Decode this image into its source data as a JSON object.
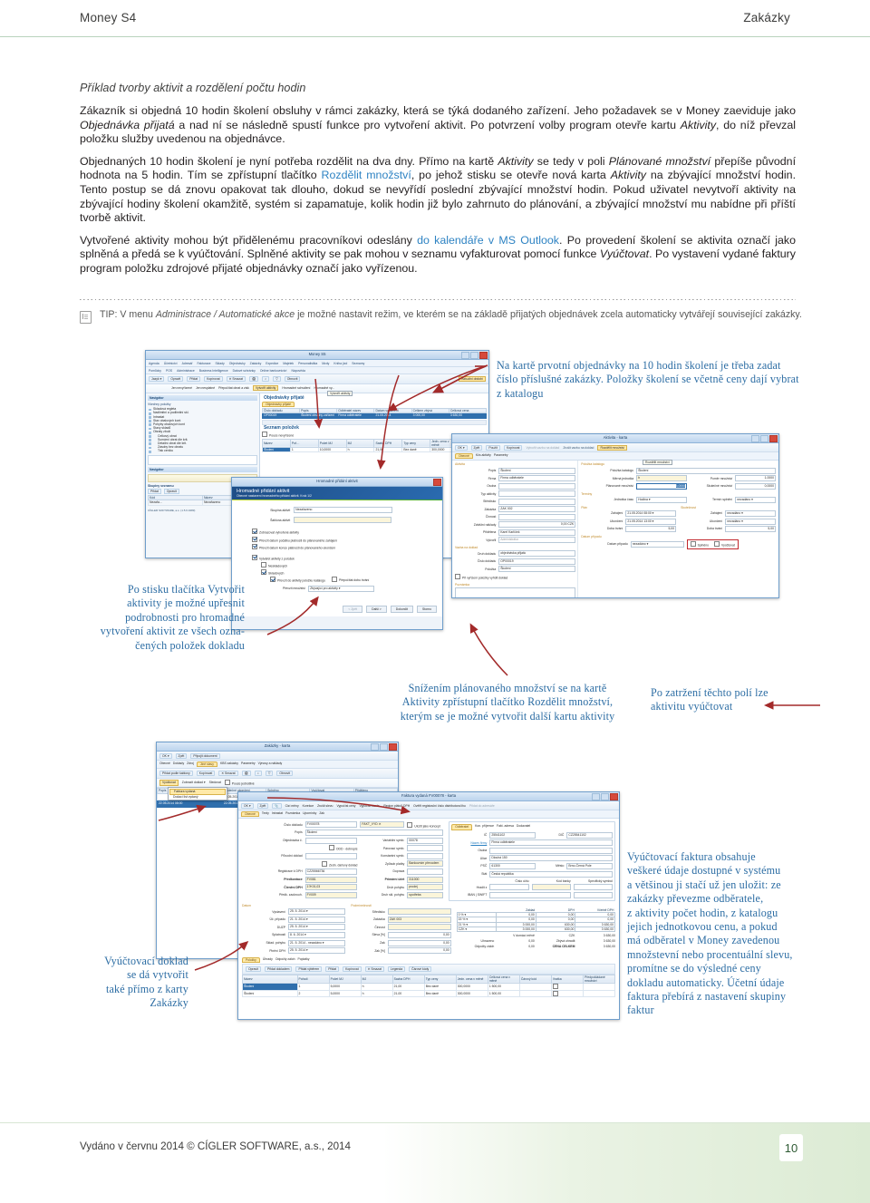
{
  "header": {
    "left_title": "Money S4",
    "right_title": "Zakázky"
  },
  "content": {
    "lead_title": "Příklad tvorby aktivit a rozdělení počtu hodin",
    "paragraph1_a": "Zákazník si objedná 10 hodin školení obsluhy v rámci zakázky, která se týká dodaného zařízení. Jeho požadavek se v Money zaeviduje jako ",
    "paragraph1_em1": "Objednávka přijatá",
    "paragraph1_b": " a nad ní se následně spustí funkce pro vytvoření aktivit. Po potvrzení volby program otevře kartu ",
    "paragraph1_em2": "Aktivity",
    "paragraph1_c": ", do níž převzal položku služby uvedenou na objednávce.",
    "paragraph2_a": "Objednaných 10 hodin školení je nyní potřeba rozdělit na dva dny. Přímo na kartě ",
    "paragraph2_em1": "Aktivity",
    "paragraph2_b": " se tedy v poli ",
    "paragraph2_em2": "Plánované množství",
    "paragraph2_c": " přepíše původní hodnota na 5 hodin. Tím se zpřístupní tlačítko ",
    "paragraph2_link": "Rozdělit množství",
    "paragraph2_d": ", po jehož stisku se otevře nová karta ",
    "paragraph2_em3": "Aktivity",
    "paragraph2_e": " na zbývající množství hodin. Tento postup se dá znovu opakovat tak dlouho, dokud se nevyřídí poslední zbývající množství hodin. Pokud uživatel nevytvoří aktivity na zbývající hodiny školení okamžitě, systém si zapamatuje, kolik hodin již bylo zahrnuto do plánování, a zbývající množství mu nabídne při příští tvorbě aktivit.",
    "paragraph3_a": "Vytvořené aktivity mohou být přidělenému pracovníkovi odeslány ",
    "paragraph3_link": "do kalendáře v MS Outlook",
    "paragraph3_b": ". Po provedení školení se aktivita označí jako splněná a předá se k vyúčtování. Splněné aktivity se pak mohou v seznamu vyfakturovat pomocí funkce ",
    "paragraph3_em1": "Vyúčtovat",
    "paragraph3_c": ". Po vystavení vydané faktury program položku zdrojové přijaté objednávky označí jako vyřízenou."
  },
  "tip": {
    "label": "TIP:",
    "text_a": " V menu ",
    "em1": "Administrace / Automatické akce",
    "text_b": " je možné nastavit režim, ve kterém se na základě přijatých objednávek zcela automaticky vytvářejí související zakázky."
  },
  "annotations": [
    {
      "id": "note-order-card",
      "lines": [
        "Na kartě prvotní objednávky na 10 hodin školení je třeba zadat",
        "číslo příslušné zakázky. Položky školení se včetně ceny dají vybrat",
        "z katalogu"
      ]
    },
    {
      "id": "note-create-activities",
      "lines": [
        "Po stisku tlačítka Vytvořit",
        "aktivity je možné upřesnit",
        "podrobnosti pro hromadné",
        "vytvoření aktivit ze všech ozna-",
        "čených položek dokladu"
      ]
    },
    {
      "id": "note-split-quantity",
      "lines": [
        "Snížením plánovaného množství se na kartě",
        "Aktivity zpřístupní tlačítko Rozdělit množství,",
        "kterým se je možné vytvořit další kartu aktivity"
      ]
    },
    {
      "id": "note-check-fields",
      "lines": [
        "Po zatržení těchto polí lze",
        "aktivitu vyúčtovat"
      ]
    },
    {
      "id": "note-billing-doc",
      "lines": [
        "Vyúčtovací doklad",
        "se dá vytvořit",
        "také přímo z karty",
        "Zakázky"
      ]
    },
    {
      "id": "note-invoice",
      "lines": [
        "Vyúčtovací faktura obsahuje",
        "veškeré údaje dostupné v systému",
        "a většinou ji stačí už jen uložit: ze",
        "zakázky převezme odběratele,",
        "z aktivity počet hodin, z katalogu",
        "jejich jednotkovou cenu, a pokud",
        "má odběratel v Money zavedenou",
        "množstevní nebo procentuální slevu,",
        "promítne se do výsledné ceny",
        "dokladu automaticky. Účetní údaje",
        "faktura přebírá z nastavení skupiny",
        "faktur"
      ]
    }
  ],
  "screenshots": {
    "money_main": {
      "window_title": "Money S5",
      "menu_row1": [
        "Agenda",
        "Účetnictví",
        "Adresář",
        "Fakturace",
        "Sklady",
        "Objednávky",
        "Zakázky",
        "Expedice",
        "Majetek",
        "Personalistika",
        "Mzdy",
        "Kniha jízd",
        "Seznamy"
      ],
      "menu_row2": [
        "Pomůcky",
        "POS",
        "Administrace",
        "Business Intelligence",
        "Datové schránky",
        "Online bankovnictví",
        "Nápověda"
      ],
      "toolbar": [
        "Jazyk",
        "Opravit",
        "Přidat",
        "Kopírovat",
        "Smazat",
        "Obnovit"
      ],
      "toolbar_highlight": "Aktuální období",
      "subtoolbar": [
        "Jen nevyřízené",
        "Jen nesplatné",
        "Přepočítat obrat a zisk"
      ],
      "subtoolbar_highlight": "Vytvořit aktivity",
      "subtoolbar_rest": [
        "Hromadné schválení",
        "Hromadné vy..."
      ],
      "navigator_title": "Navigátor",
      "navigator_sub": "Všechny položky",
      "navigator_items": [
        "Skladová regleta",
        "Nadlimitní a podlimitní skl.",
        "Intrastat",
        "Stav obalových kont",
        "Pohyby obalových kont",
        "Stavy skladů",
        "Obraty zboží",
        "Celkový obrat",
        "Sumární obrat dle kmb",
        "Detailní obrat dle kmb",
        "Zásoby bez obratu",
        "Tisk ceníku"
      ],
      "navigator_panel2": "Navigátor",
      "groups_title": "Skupiny seznamu",
      "groups_buttons": [
        "Přidat",
        "Opravit"
      ],
      "groups_cols": [
        "Kód",
        "Název"
      ],
      "groups_row": [
        "Nezařa...",
        "Nezařazeno"
      ],
      "statusbar": "CÍGLER SOFTWARE, a.s. (1.5.6.3483)",
      "list_title": "Objednávky přijaté",
      "list_tab": "Objednávky přijaté",
      "list_columns": [
        "Číslo dokladu",
        "Popis",
        "Odběratel název",
        "Datum vystavení",
        "Celkem zbývá",
        "Celková cena"
      ],
      "list_row": [
        "OP00019",
        "Školení obsluhy zařízení",
        "Firma odběratele",
        "21.05.2014",
        "3 000,00",
        "3 630,00"
      ],
      "items_title": "Seznam položek",
      "items_filter": "Pouze nevyřízené",
      "items_columns": [
        "Název",
        "Pořadí",
        "Počet MJ",
        "MJ",
        "Sazba DPH",
        "Typ ceny",
        "Jedn. cena v měně",
        "Celková cena v měně"
      ],
      "items_row": [
        "Školení",
        "1",
        "10,0000",
        "h",
        "21,00",
        "Bez daně",
        "300,0000",
        "3 000,00"
      ],
      "tooltip": "Vytvořit aktivity"
    },
    "bulk_wizard": {
      "window_title": "Hromadné přidání aktivit",
      "wizard_title": "Hromadné přidání aktivit",
      "wizard_subtitle": "Obecné nastavení hromadného přidání aktivit. Krok 1/2",
      "field_group_label": "Skupina aktivit",
      "field_group_value": "Nezařazeno",
      "field_template_label": "Šablona aktivit",
      "field_template_value": "",
      "checks": [
        {
          "label": "Zobrazovat vytvořené aktivity",
          "checked": true
        },
        {
          "label": "Převzít datum počátku platnosti do plánovaného zahájení",
          "checked": true
        },
        {
          "label": "Převzít datum konce platnosti do plánovaného ukončení",
          "checked": true
        },
        {
          "label": "Vytvářet aktivity z položek",
          "checked": true
        },
        {
          "label": "Nesk1adových",
          "checked": false
        },
        {
          "label": "Skladových",
          "checked": true
        },
        {
          "label": "Převzít do aktivity položku katalogu",
          "checked": true
        },
        {
          "label": "Přepočítat dobu trvání",
          "checked": false
        }
      ],
      "transfer_label": "Převzít množství",
      "transfer_value": "Zbývající pro aktivity",
      "buttons": [
        "< Zpět",
        "Další >",
        "Dokončit",
        "Storno"
      ]
    },
    "activity_card": {
      "window_title": "Aktivita - karta",
      "toolbar": [
        "OK",
        "Zpět",
        "Použít",
        "Kopírovat",
        "Vytvořit vazbu na doklad",
        "Zrušit vazbu na doklad"
      ],
      "toolbar_highlight": "Rozdělit množství",
      "tabs": [
        "Obecné",
        "Kčs aktivity",
        "Parametry"
      ],
      "section_activity": "Aktivita",
      "left_fields": [
        {
          "label": "Popis",
          "value": "Školení"
        },
        {
          "label": "Firma",
          "value": "Firma odběratele"
        },
        {
          "label": "Osoba",
          "value": ""
        },
        {
          "label": "Typ aktivity",
          "value": ""
        },
        {
          "label": "Středisko",
          "value": ""
        },
        {
          "label": "Zakázka",
          "value": "ZAK 002"
        },
        {
          "label": "Činnost",
          "value": ""
        },
        {
          "label": "Zvláštní náklady",
          "value": ""
        },
        {
          "label": "Přidělena",
          "value": "Karel Karlíček"
        },
        {
          "label": "Vytvořil",
          "value": "Administrátor"
        }
      ],
      "section_doc": "Vazba na doklad",
      "doc_fields": [
        {
          "label": "Druh dokladu",
          "value": "objednávka přijatá"
        },
        {
          "label": "Číslo dokladu",
          "value": "OP00019"
        },
        {
          "label": "Položka",
          "value": "Školení"
        }
      ],
      "doc_check": "Při vyřízení položky vyřídit doklad",
      "section_note": "Poznámka",
      "section_catalog": "Položka katalogu",
      "catalog_fields": [
        {
          "label": "Položka katalogu",
          "value": "Školení"
        },
        {
          "label": "Měrná jednotka",
          "value": "h"
        },
        {
          "label": "Plánované množství",
          "value": "5,0000"
        },
        {
          "label": "Poměr množství",
          "value": "1,0000"
        },
        {
          "label": "Skutečné množství",
          "value": "0,0000"
        }
      ],
      "section_terms": "Termíny",
      "term_unit_label": "Jednotka času",
      "term_unit_value": "Hodina",
      "term_done_label": "Termín splnění",
      "term_done_value": "nezadáno",
      "section_plan": "Plán",
      "plan_rows": [
        {
          "label": "Zahájení",
          "value": "21.05.2014 08:00"
        },
        {
          "label": "Ukončení",
          "value": "21.05.2014 13:00"
        },
        {
          "label": "Doba trvání",
          "value": "5,00"
        }
      ],
      "section_real": "Skutečnost",
      "real_rows": [
        {
          "label": "Zahájení",
          "value": "nezadáno"
        },
        {
          "label": "Ukončení",
          "value": "nezadáno"
        },
        {
          "label": "Doba trvání",
          "value": "5,00"
        }
      ],
      "section_case": "Datum případu",
      "case_label": "Datum případu",
      "case_value": "nezadáno",
      "case_checks": [
        "Splněno",
        "Vyúčtovat"
      ],
      "tooltip": "Rozdělit množství"
    },
    "order_card": {
      "window_title": "Zakázky - karta",
      "toolbar": [
        "OK",
        "Zpět",
        "Připojit dokument"
      ],
      "tabs": [
        "Obecné",
        "Doklady",
        "Zdroj",
        "Jiné stavy",
        "KBS zakázky",
        "Parametry",
        "Výnosy a náklady"
      ],
      "toolbar2": [
        "Přidat podle šablony",
        "Kopírovat",
        "Smazat",
        "Obnovit"
      ],
      "toolbar3_highlight": "Vyúčtovat",
      "toolbar3": [
        "Zobrazit doklad",
        "Sledovat",
        "Pouze jednotlivé"
      ],
      "menu_items": [
        {
          "label": "Faktura vydaná",
          "active": true
        },
        {
          "label": "Dodací list vydaný",
          "active": false
        }
      ],
      "columns": [
        "Skutečné ukončení",
        "Splněno",
        "Vyúčtovat",
        "Přiděleno"
      ],
      "rows": [
        {
          "date": "21.05.2014 13:00",
          "done": true,
          "bill": true,
          "user": "Karlíček Karel"
        },
        {
          "date": "22.05.2014 13:00",
          "done": true,
          "bill": true,
          "user": "Karlíček Karel"
        }
      ]
    },
    "invoice_card": {
      "window_title": "Faktura vydaná FV00078 - karta",
      "toolbar": [
        "OK",
        "Zpět",
        "Cizí měny",
        "Korekce",
        "Zrušit slevu",
        "Vypočíst ceny",
        "Vypočíst zaokr.",
        "Region plátců DPH",
        "Ověřit registrační číslo distributora lihu",
        "Přidat do adresáře"
      ],
      "tabs": [
        "Obecné",
        "Texty",
        "Intrastat",
        "Poznámka",
        "Upomínky",
        "Zak"
      ],
      "left_fields": [
        {
          "label": "Číslo dokladu",
          "value": "FV00078"
        },
        {
          "label": "Popis",
          "value": "Školení"
        },
        {
          "label": "Objednávka č.",
          "value": ""
        },
        {
          "label": "Původní doklad",
          "value": ""
        },
        {
          "label": "Registrace k DPH",
          "value": "CZ25566736"
        },
        {
          "label": "Předkontace",
          "value": "FV081"
        },
        {
          "label": "Členění DPH",
          "value": "1?K01,03"
        },
        {
          "label": "Předk. zaokrouh.",
          "value": "FV009"
        }
      ],
      "left_sel": "FAKT_VYD",
      "left_check1": "Uložit jako koncept",
      "left_check2": "Zedn. daňový doklad",
      "left_check3": "ODD - dobropis",
      "mid_fields": [
        {
          "label": "Variabilní symb.",
          "value": "00078"
        },
        {
          "label": "Párovací symb.",
          "value": ""
        },
        {
          "label": "Konstantní symb.",
          "value": ""
        },
        {
          "label": "Způsob platby",
          "value": "Bankovním převodem"
        },
        {
          "label": "Doprava",
          "value": ""
        },
        {
          "label": "Primární účet",
          "value": "311000"
        },
        {
          "label": "Druh pohybu",
          "value": "prodej"
        },
        {
          "label": "Druh skl. pohybu",
          "value": "spotřeba"
        }
      ],
      "addr_tabs": [
        "Odběratel",
        "Kon. příjemce",
        "Fakt. adresa",
        "Dodavatel"
      ],
      "addr_fields": [
        {
          "label": "IČ",
          "value": "25541102"
        },
        {
          "label": "DIČ",
          "value": "CZ25541102"
        },
        {
          "label": "Název firmy",
          "value": "Firma odběratele"
        },
        {
          "label": "Osoba",
          "value": ""
        },
        {
          "label": "Ulice",
          "value": "Dlouhá 150"
        },
        {
          "label": "PSČ",
          "value": "61300"
        },
        {
          "label": "Město",
          "value": "Brno-Černá Pole"
        },
        {
          "label": "Stát",
          "value": "Česká republika"
        }
      ],
      "bank_cols": [
        "Číslo účtu",
        "Kód banky",
        "Specifický symbol"
      ],
      "bank_rows": [
        {
          "label": "Hradit z",
          "value": ""
        },
        {
          "label": "IBAN | SWIFT",
          "value": ""
        }
      ],
      "date_section": "Datum",
      "dates": [
        {
          "label": "Vystavení",
          "value": "25. 5. 2014"
        },
        {
          "label": "Úč. případu",
          "value": "21. 5. 2014"
        },
        {
          "label": "DUZP",
          "value": "25. 5. 2014"
        },
        {
          "label": "Splatnosti",
          "value": "8. 6. 2014"
        },
        {
          "label": "Sklad. pohybu",
          "value": "21. 5. 2014 - nezadáno"
        },
        {
          "label": "Plnění DPH",
          "value": "25. 5. 2014"
        }
      ],
      "cond_section": "Podmínečnosti",
      "conditions": [
        {
          "label": "Středisko",
          "value": ""
        },
        {
          "label": "Zakázka",
          "value": "ZAK 003"
        },
        {
          "label": "Činnost",
          "value": ""
        },
        {
          "label": "Sleva [%]",
          "value": "0,00"
        },
        {
          "label": "Zak",
          "value": "0,00"
        },
        {
          "label": "Zak [%]",
          "value": "0,00"
        }
      ],
      "vat_headers": [
        "Základ",
        "DPH",
        "Včetně DPH"
      ],
      "vat_rows": [
        {
          "rate": "0 %",
          "base": "0,00",
          "vat": "0,00",
          "total": "0,00"
        },
        {
          "rate": "15 %",
          "base": "0,00",
          "vat": "0,00",
          "total": "0,00"
        },
        {
          "rate": "21 %",
          "base": "3 000,00",
          "vat": "630,00",
          "total": "3 630,00"
        },
        {
          "rate": "CZK",
          "base": "3 000,00",
          "vat": "630,00",
          "total": "3 630,00"
        }
      ],
      "currency_note": "V domácí měně",
      "currency_code": "CZK",
      "sum_rows": [
        {
          "label": "Uhrazeno",
          "value": "0,00",
          "label2": "Zbývá uhradit",
          "value2": "3 630,00"
        },
        {
          "label": "Odpočty záloh",
          "value": "0,00",
          "label2": "CENA CELKEM",
          "value2": "3 630,00"
        }
      ],
      "items_tabs": [
        "Položky",
        "Úhrady",
        "Odpočty záloh",
        "Poplatky"
      ],
      "items_toolbar": [
        "Opravit",
        "Přidat dokladem",
        "Přidat výběrem",
        "Přidat",
        "Kopírovat",
        "Smazat",
        "Legenda",
        "Čárové kódy"
      ],
      "items_columns": [
        "Název",
        "Pořadí",
        "Počet MJ",
        "MJ",
        "Sazba DPH",
        "Typ ceny",
        "Jedn. cena v měně",
        "Celková cena v měně",
        "Čárový kód",
        "Vratka",
        "Předpokládané množství"
      ],
      "items_rows": [
        [
          "Školení",
          "1",
          "5,0000",
          "h",
          "21,00",
          "Bez daně",
          "300,0000",
          "1 500,00"
        ],
        [
          "Školení",
          "2",
          "5,0000",
          "h",
          "21,00",
          "Bez daně",
          "300,0000",
          "1 500,00"
        ]
      ]
    }
  },
  "footer": {
    "text": "Vydáno v červnu 2014 © CÍGLER SOFTWARE, a.s., 2014",
    "page": "10"
  },
  "colors": {
    "accent_green": "#b9d3bd",
    "link_blue": "#2e83c3",
    "note_blue": "#2b6ca3",
    "arrow_red": "#a32a2a",
    "footer_green": "#dcebd4"
  }
}
